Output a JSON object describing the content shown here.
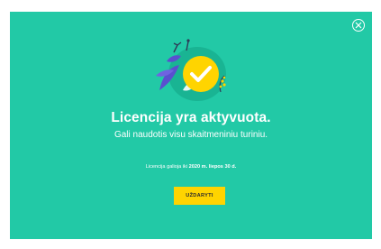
{
  "modal": {
    "title": "Licencija yra aktyvuota.",
    "subtitle": "Gali naudotis visu skaitmeniniu turiniu.",
    "validity_prefix": "Licencija galioja iki",
    "validity_date": "2020 m. liepos 30 d.",
    "close_button_label": "UŽDARYTI",
    "close_icon": "close-circle-icon",
    "illustration_icon": "check-badge-icon"
  },
  "colors": {
    "background": "#22c9a6",
    "accent": "#ffd400",
    "text": "#ffffff",
    "illustration_purple": "#5a4fcf",
    "illustration_green": "#17a98a"
  }
}
